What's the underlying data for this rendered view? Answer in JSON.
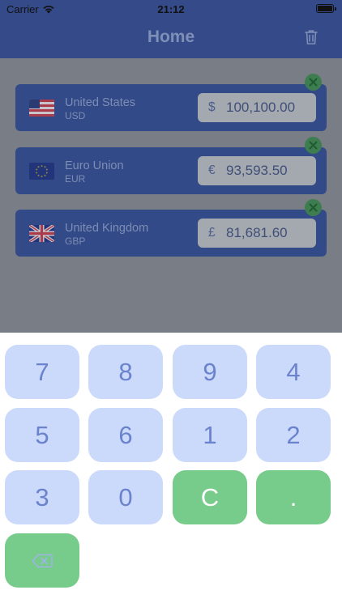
{
  "status": {
    "carrier": "Carrier",
    "time": "21:12"
  },
  "header": {
    "title": "Home",
    "trash_icon": "trash-icon"
  },
  "currencies": [
    {
      "country": "United States",
      "code": "USD",
      "symbol": "$",
      "amount": "100,100.00",
      "flag": "us-flag-icon"
    },
    {
      "country": "Euro Union",
      "code": "EUR",
      "symbol": "€",
      "amount": "93,593.50",
      "flag": "eu-flag-icon"
    },
    {
      "country": "United Kingdom",
      "code": "GBP",
      "symbol": "£",
      "amount": "81,681.60",
      "flag": "uk-flag-icon"
    }
  ],
  "keypad": {
    "keys": [
      "7",
      "8",
      "9",
      "4",
      "5",
      "6",
      "1",
      "2",
      "3",
      "0",
      "C",
      "."
    ],
    "backspace_icon": "backspace-icon"
  },
  "colors": {
    "header": "#344a89",
    "card": "#334a89",
    "key": "#cbd9fb",
    "key_text": "#6b83cd",
    "green_key": "#77cc8b",
    "remove_badge": "#3d7d4f"
  }
}
